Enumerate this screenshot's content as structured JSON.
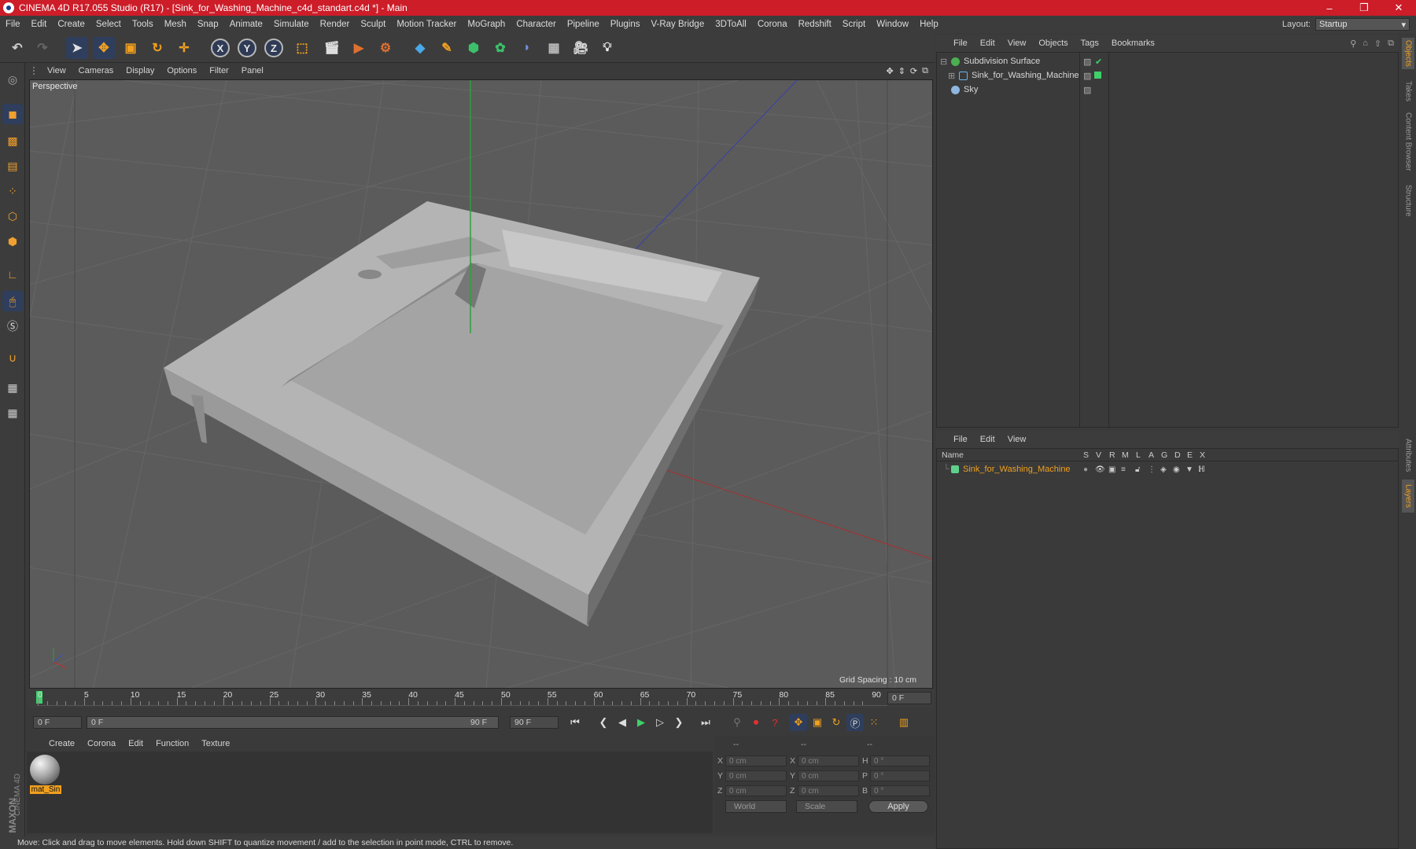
{
  "window": {
    "title": "CINEMA 4D R17.055 Studio (R17) - [Sink_for_Washing_Machine_c4d_standart.c4d *] - Main",
    "minimize": "–",
    "maximize": "❐",
    "close": "✕"
  },
  "menubar": {
    "items": [
      "File",
      "Edit",
      "Create",
      "Select",
      "Tools",
      "Mesh",
      "Snap",
      "Animate",
      "Simulate",
      "Render",
      "Sculpt",
      "Motion Tracker",
      "MoGraph",
      "Character",
      "Pipeline",
      "Plugins",
      "V-Ray Bridge",
      "3DToAll",
      "Corona",
      "Redshift",
      "Script",
      "Window",
      "Help"
    ],
    "layout_label": "Layout:",
    "layout_value": "Startup"
  },
  "toolbar": {
    "axis_x": "X",
    "axis_y": "Y",
    "axis_z": "Z"
  },
  "viewport": {
    "menu": [
      "View",
      "Cameras",
      "Display",
      "Options",
      "Filter",
      "Panel"
    ],
    "label": "Perspective",
    "grid_spacing": "Grid Spacing : 10 cm"
  },
  "timeline": {
    "ticks": [
      "0",
      "5",
      "10",
      "15",
      "20",
      "25",
      "30",
      "35",
      "40",
      "45",
      "50",
      "55",
      "60",
      "65",
      "70",
      "75",
      "80",
      "85",
      "90"
    ],
    "current_frame": "0 F",
    "start_field": "0 F",
    "range_start": "0 F",
    "range_end": "90 F",
    "end_field": "90 F"
  },
  "material_manager": {
    "menu": [
      "Create",
      "Corona",
      "Edit",
      "Function",
      "Texture"
    ],
    "materials": [
      {
        "label": "mat_Sin"
      }
    ]
  },
  "coordinates": {
    "headers": [
      "--",
      "--",
      "--"
    ],
    "rows": [
      {
        "a": "X",
        "av": "0 cm",
        "b": "X",
        "bv": "0 cm",
        "c": "H",
        "cv": "0 °"
      },
      {
        "a": "Y",
        "av": "0 cm",
        "b": "Y",
        "bv": "0 cm",
        "c": "P",
        "cv": "0 °"
      },
      {
        "a": "Z",
        "av": "0 cm",
        "b": "Z",
        "bv": "0 cm",
        "c": "B",
        "cv": "0 °"
      }
    ],
    "mode1": "World",
    "mode2": "Scale",
    "apply": "Apply"
  },
  "status_bar": "Move: Click and drag to move elements. Hold down SHIFT to quantize movement / add to the selection in point mode, CTRL to remove.",
  "object_manager": {
    "menu": [
      "File",
      "Edit",
      "View",
      "Objects",
      "Tags",
      "Bookmarks"
    ],
    "objects": [
      {
        "name": "Subdivision Surface",
        "color": "#4caf50"
      },
      {
        "name": "Sink_for_Washing_Machine",
        "color": "#6ab4e8"
      },
      {
        "name": "Sky",
        "color": "#8fb6e0"
      }
    ]
  },
  "layer_manager": {
    "menu": [
      "File",
      "Edit",
      "View"
    ],
    "columns": [
      "Name",
      "S",
      "V",
      "R",
      "M",
      "L",
      "A",
      "G",
      "D",
      "E",
      "X"
    ],
    "layers": [
      {
        "name": "Sink_for_Washing_Machine",
        "color": "#5fd08a"
      }
    ]
  },
  "side_tabs": [
    "Objects",
    "Takes",
    "Content Browser",
    "Structure",
    "Attributes",
    "Layers"
  ],
  "brand": {
    "line1": "MAXON",
    "line2": "CINEMA 4D"
  },
  "colors": {
    "accent": "#f0a020",
    "title_bar": "#cc1d29",
    "selected_layer_text": "#f0a020"
  }
}
